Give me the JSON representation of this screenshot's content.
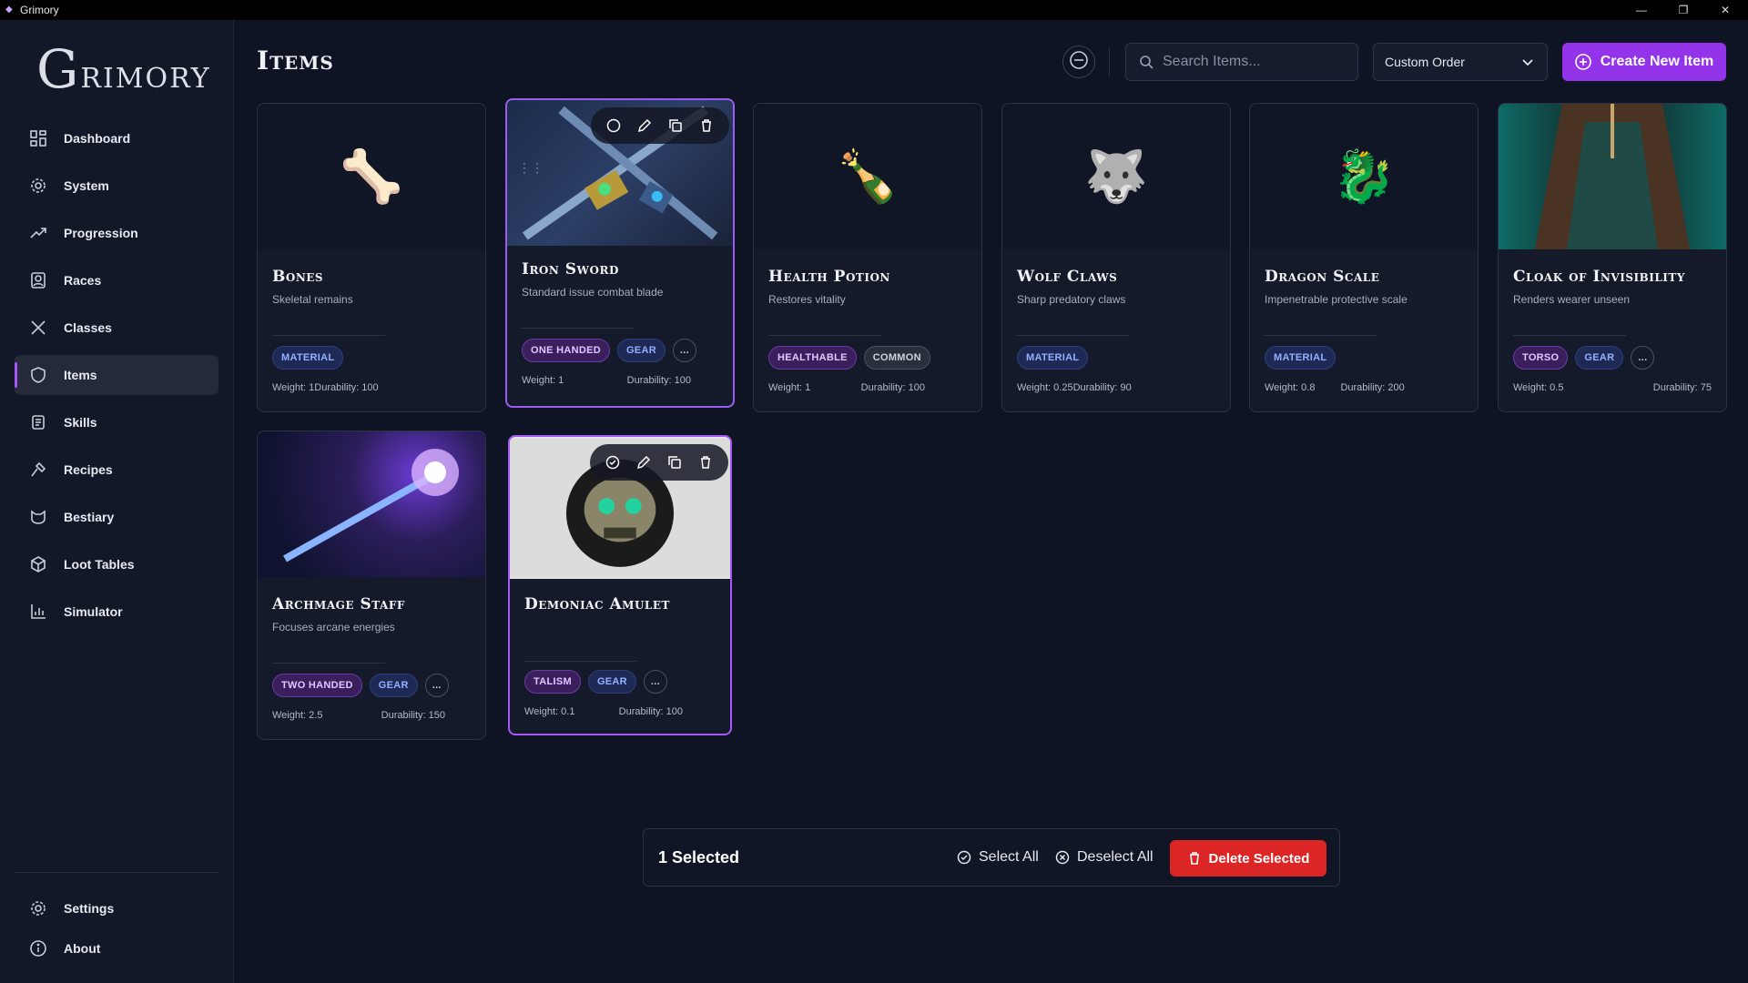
{
  "window": {
    "title": "Grimory",
    "minimize": "—",
    "restore": "❐",
    "close": "✕"
  },
  "logo": {
    "first": "G",
    "rest": "RIMORY"
  },
  "sidebar": {
    "items": [
      {
        "label": "Dashboard",
        "icon": "dashboard-icon"
      },
      {
        "label": "System",
        "icon": "gear-icon"
      },
      {
        "label": "Progression",
        "icon": "trend-icon"
      },
      {
        "label": "Races",
        "icon": "portrait-icon"
      },
      {
        "label": "Classes",
        "icon": "crossed-swords-icon"
      },
      {
        "label": "Items",
        "icon": "shield-icon",
        "active": true
      },
      {
        "label": "Skills",
        "icon": "scroll-icon"
      },
      {
        "label": "Recipes",
        "icon": "hammer-icon"
      },
      {
        "label": "Bestiary",
        "icon": "beast-icon"
      },
      {
        "label": "Loot Tables",
        "icon": "box-icon"
      },
      {
        "label": "Simulator",
        "icon": "bar-chart-icon"
      }
    ],
    "bottom": [
      {
        "label": "Settings",
        "icon": "gear-icon"
      },
      {
        "label": "About",
        "icon": "info-icon"
      }
    ]
  },
  "header": {
    "title": "Items",
    "search_placeholder": "Search Items...",
    "sort_value": "Custom Order",
    "create_label": "Create New Item"
  },
  "items": [
    {
      "name": "Bones",
      "desc": "Skeletal remains",
      "tags": [
        "MATERIAL"
      ],
      "weight": "Weight: 1",
      "durability": "Durability: 100",
      "emoji": "🦴"
    },
    {
      "name": "Iron Sword",
      "desc": "Standard issue combat blade",
      "tags": [
        "ONE HANDED",
        "GEAR"
      ],
      "more": "...",
      "weight": "Weight: 1",
      "durability": "Durability: 100"
    },
    {
      "name": "Health Potion",
      "desc": "Restores vitality",
      "tags": [
        "HEALTHABLE",
        "COMMON"
      ],
      "weight": "Weight: 1",
      "durability": "Durability: 100",
      "emoji": "🍾"
    },
    {
      "name": "Wolf Claws",
      "desc": "Sharp predatory claws",
      "tags": [
        "MATERIAL"
      ],
      "weight": "Weight: 0.25",
      "durability": "Durability: 90",
      "emoji": "🐺"
    },
    {
      "name": "Dragon Scale",
      "desc": "Impenetrable protective scale",
      "tags": [
        "MATERIAL"
      ],
      "weight": "Weight: 0.8",
      "durability": "Durability: 200",
      "emoji": "🐉"
    },
    {
      "name": "Cloak of Invisibility",
      "desc": "Renders wearer unseen",
      "tags": [
        "TORSO",
        "GEAR"
      ],
      "more": "...",
      "weight": "Weight: 0.5",
      "durability": "Durability: 75"
    },
    {
      "name": "Archmage Staff",
      "desc": "Focuses arcane energies",
      "tags": [
        "TWO HANDED",
        "GEAR"
      ],
      "more": "...",
      "weight": "Weight: 2.5",
      "durability": "Durability: 150"
    },
    {
      "name": "Demoniac Amulet",
      "desc": "",
      "tags": [
        "TALISM",
        "GEAR"
      ],
      "more": "...",
      "weight": "Weight: 0.1",
      "durability": "Durability: 100"
    }
  ],
  "selection": {
    "count_label": "1 Selected",
    "select_all": "Select All",
    "deselect_all": "Deselect All",
    "delete_label": "Delete Selected"
  },
  "colors": {
    "accent": "#9333ea",
    "danger": "#dc2626",
    "bg": "#0f1424"
  }
}
